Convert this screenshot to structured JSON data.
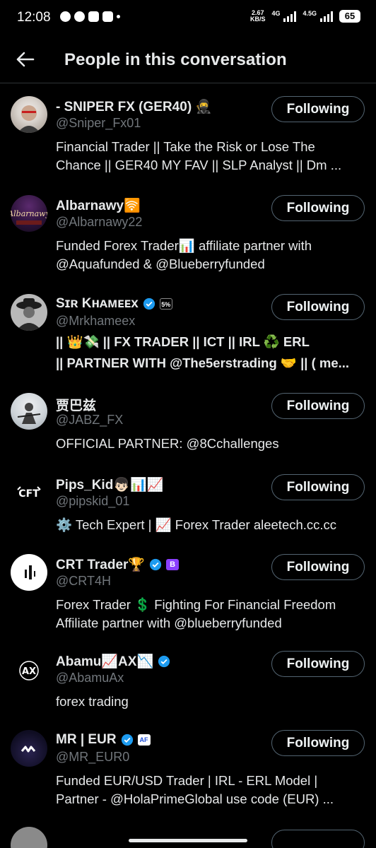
{
  "status": {
    "time": "12:08",
    "net_speed": "2.67",
    "net_unit": "KB/S",
    "sig1": "4G",
    "sig2": "4.5G",
    "battery": "65"
  },
  "header": {
    "title": "People in this conversation"
  },
  "colors": {
    "bg": "#000000",
    "text": "#e7e9ea",
    "muted": "#71767b",
    "verified": "#1d9bf0",
    "border": "#536471"
  },
  "people": [
    {
      "name": "- SNIPER FX (GER40) 🥷",
      "handle": "@Sniper_Fx01",
      "button": "Following",
      "bio": [
        "Financial Trader || Take the Risk or Lose The",
        "Chance || GER40 MY FAV  || SLP Analyst || Dm ..."
      ]
    },
    {
      "name": "Albarnawy🛜",
      "handle": "@Albarnawy22",
      "button": "Following",
      "bio": [
        "Funded Forex Trader📊 affiliate partner with",
        "@Aquafunded & @Blueberryfunded"
      ]
    },
    {
      "name": "Sɪʀ Kʜᴀᴍᴇᴇx",
      "handle": "@Mrkhameex",
      "button": "Following",
      "bio": [
        "|| 👑💸 || FX TRADER || ICT || IRL ♻️ ERL",
        "|| PARTNER WITH @The5erstrading 🤝 || ( me..."
      ]
    },
    {
      "name": "贾巴兹",
      "handle": "@JABZ_FX",
      "button": "Following",
      "bio": [
        "OFFICIAL PARTNER: @8Cchallenges"
      ]
    },
    {
      "name": "Pips_Kid👦🏻📊📈",
      "handle": "@pipskid_01",
      "button": "Following",
      "bio": [
        "⚙️ Tech Expert | 📈 Forex Trader aleetech.cc.cc"
      ]
    },
    {
      "name": "CRT Trader🏆",
      "handle": "@CRT4H",
      "button": "Following",
      "bio": [
        "Forex Trader 💲 Fighting For Financial Freedom",
        "Affiliate partner with @blueberryfunded"
      ]
    },
    {
      "name": "Abamu📈AX📉",
      "handle": "@AbamuAx",
      "button": "Following",
      "bio": [
        "forex trading"
      ]
    },
    {
      "name": "MR | EUR",
      "handle": "@MR_EUR0",
      "button": "Following",
      "bio": [
        "Funded EUR/USD Trader | IRL - ERL Model |",
        "Partner - @HolaPrimeGlobal use code (EUR) ..."
      ]
    }
  ]
}
